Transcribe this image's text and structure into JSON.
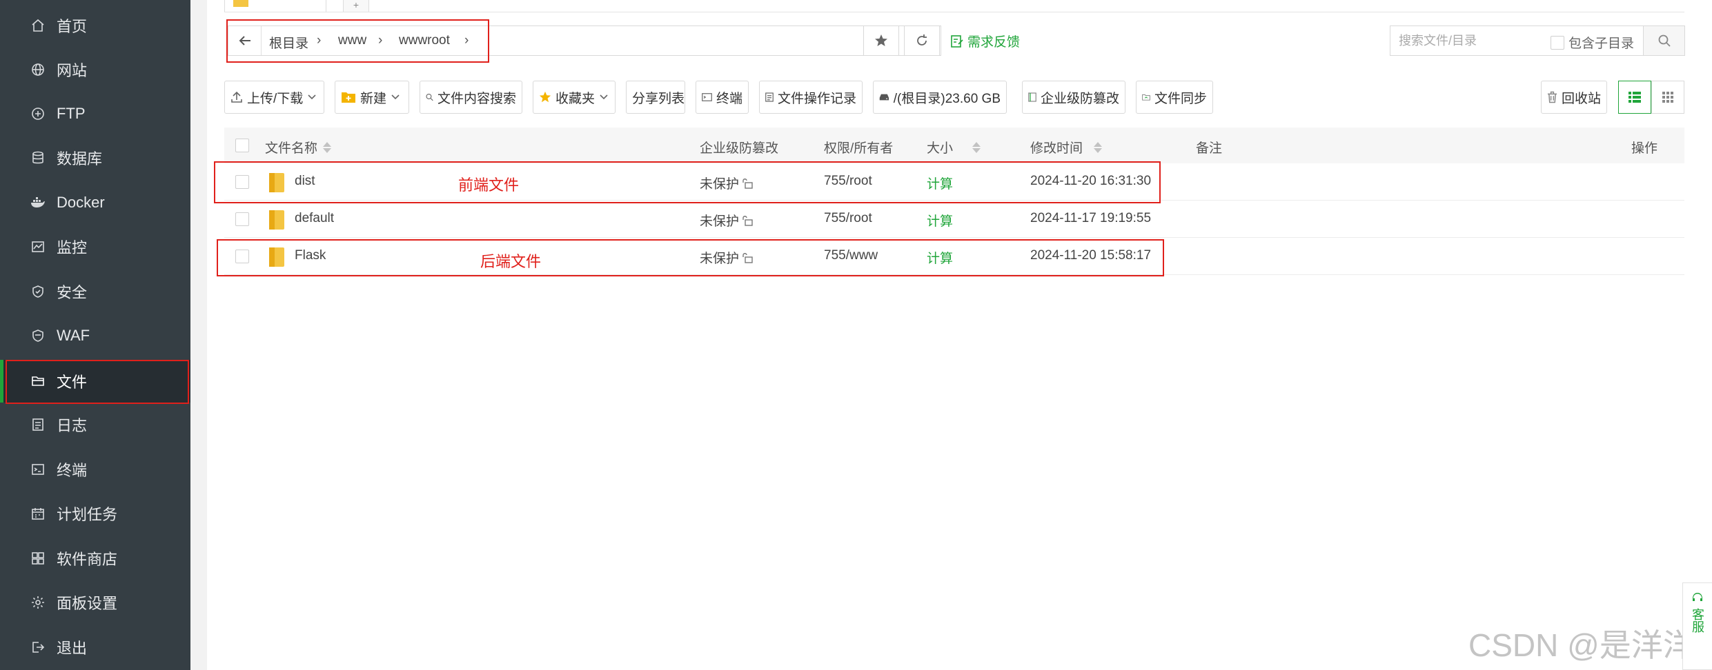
{
  "sidebar": {
    "items": [
      {
        "label": "首页",
        "icon": "home-icon"
      },
      {
        "label": "网站",
        "icon": "globe-icon"
      },
      {
        "label": "FTP",
        "icon": "ftp-icon"
      },
      {
        "label": "数据库",
        "icon": "database-icon"
      },
      {
        "label": "Docker",
        "icon": "docker-icon"
      },
      {
        "label": "监控",
        "icon": "monitor-icon"
      },
      {
        "label": "安全",
        "icon": "shield-icon"
      },
      {
        "label": "WAF",
        "icon": "waf-shield-icon"
      },
      {
        "label": "文件",
        "icon": "folder-icon",
        "active": true
      },
      {
        "label": "日志",
        "icon": "log-icon"
      },
      {
        "label": "终端",
        "icon": "terminal-icon"
      },
      {
        "label": "计划任务",
        "icon": "calendar-icon"
      },
      {
        "label": "软件商店",
        "icon": "apps-icon"
      },
      {
        "label": "面板设置",
        "icon": "gear-icon"
      },
      {
        "label": "退出",
        "icon": "logout-icon"
      }
    ]
  },
  "pathbar": {
    "crumbs": [
      "根目录",
      "www",
      "wwwroot"
    ],
    "feedback": "需求反馈"
  },
  "search": {
    "placeholder": "搜索文件/目录",
    "subdir_label": "包含子目录"
  },
  "toolbar": {
    "upload": "上传/下载",
    "new": "新建",
    "content_search": "文件内容搜索",
    "favorites": "收藏夹",
    "share_list": "分享列表",
    "terminal": "终端",
    "op_log": "文件操作记录",
    "disk": "/(根目录)23.60 GB",
    "tamper": "企业级防篡改",
    "sync": "文件同步",
    "recycle": "回收站"
  },
  "table": {
    "headers": {
      "name": "文件名称",
      "tamper": "企业级防篡改",
      "perm": "权限/所有者",
      "size": "大小",
      "mtime": "修改时间",
      "note": "备注",
      "ops": "操作"
    },
    "rows": [
      {
        "name": "dist",
        "tamper": "未保护",
        "perm": "755/root",
        "size": "计算",
        "mtime": "2024-11-20 16:31:30"
      },
      {
        "name": "default",
        "tamper": "未保护",
        "perm": "755/root",
        "size": "计算",
        "mtime": "2024-11-17 19:19:55"
      },
      {
        "name": "Flask",
        "tamper": "未保护",
        "perm": "755/www",
        "size": "计算",
        "mtime": "2024-11-20 15:58:17"
      }
    ]
  },
  "annotations": {
    "frontend": "前端文件",
    "backend": "后端文件"
  },
  "kefu": "客服",
  "watermark": "CSDN @是洋洋a",
  "colors": {
    "sidebar_bg": "#353e44",
    "accent_green": "#20a53a",
    "annotation_red": "#e0201b"
  }
}
